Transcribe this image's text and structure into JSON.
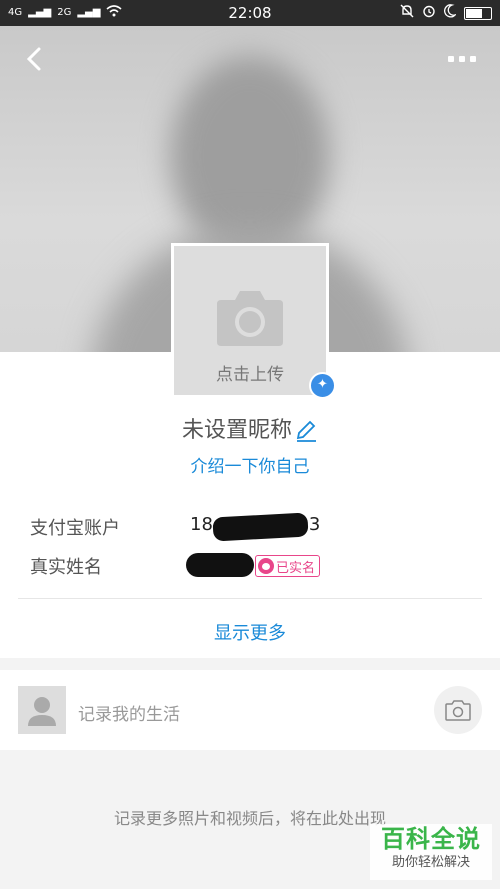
{
  "status_bar": {
    "signal_left": "4G",
    "signal_right": "2G",
    "time": "22:08"
  },
  "profile": {
    "avatar_upload_label": "点击上传",
    "nickname": "未设置昵称",
    "intro_link": "介绍一下你自己",
    "fields": [
      {
        "label": "支付宝账户",
        "value_visible_start": "18",
        "value_visible_end": "3"
      },
      {
        "label": "真实姓名",
        "badge": "已实名"
      }
    ],
    "show_more": "显示更多"
  },
  "post": {
    "placeholder": "记录我的生活"
  },
  "empty_hint": "记录更多照片和视频后，将在此处出现",
  "watermark": {
    "title": "百科全说",
    "subtitle": "助你轻松解决"
  },
  "colors": {
    "accent_blue": "#1a8ad8",
    "badge_pink": "#e8468a",
    "watermark_green": "#3ab54a"
  },
  "icons": [
    "back-icon",
    "more-icon",
    "camera-icon",
    "verified-icon",
    "edit-icon",
    "user-icon",
    "camera-button-icon"
  ]
}
